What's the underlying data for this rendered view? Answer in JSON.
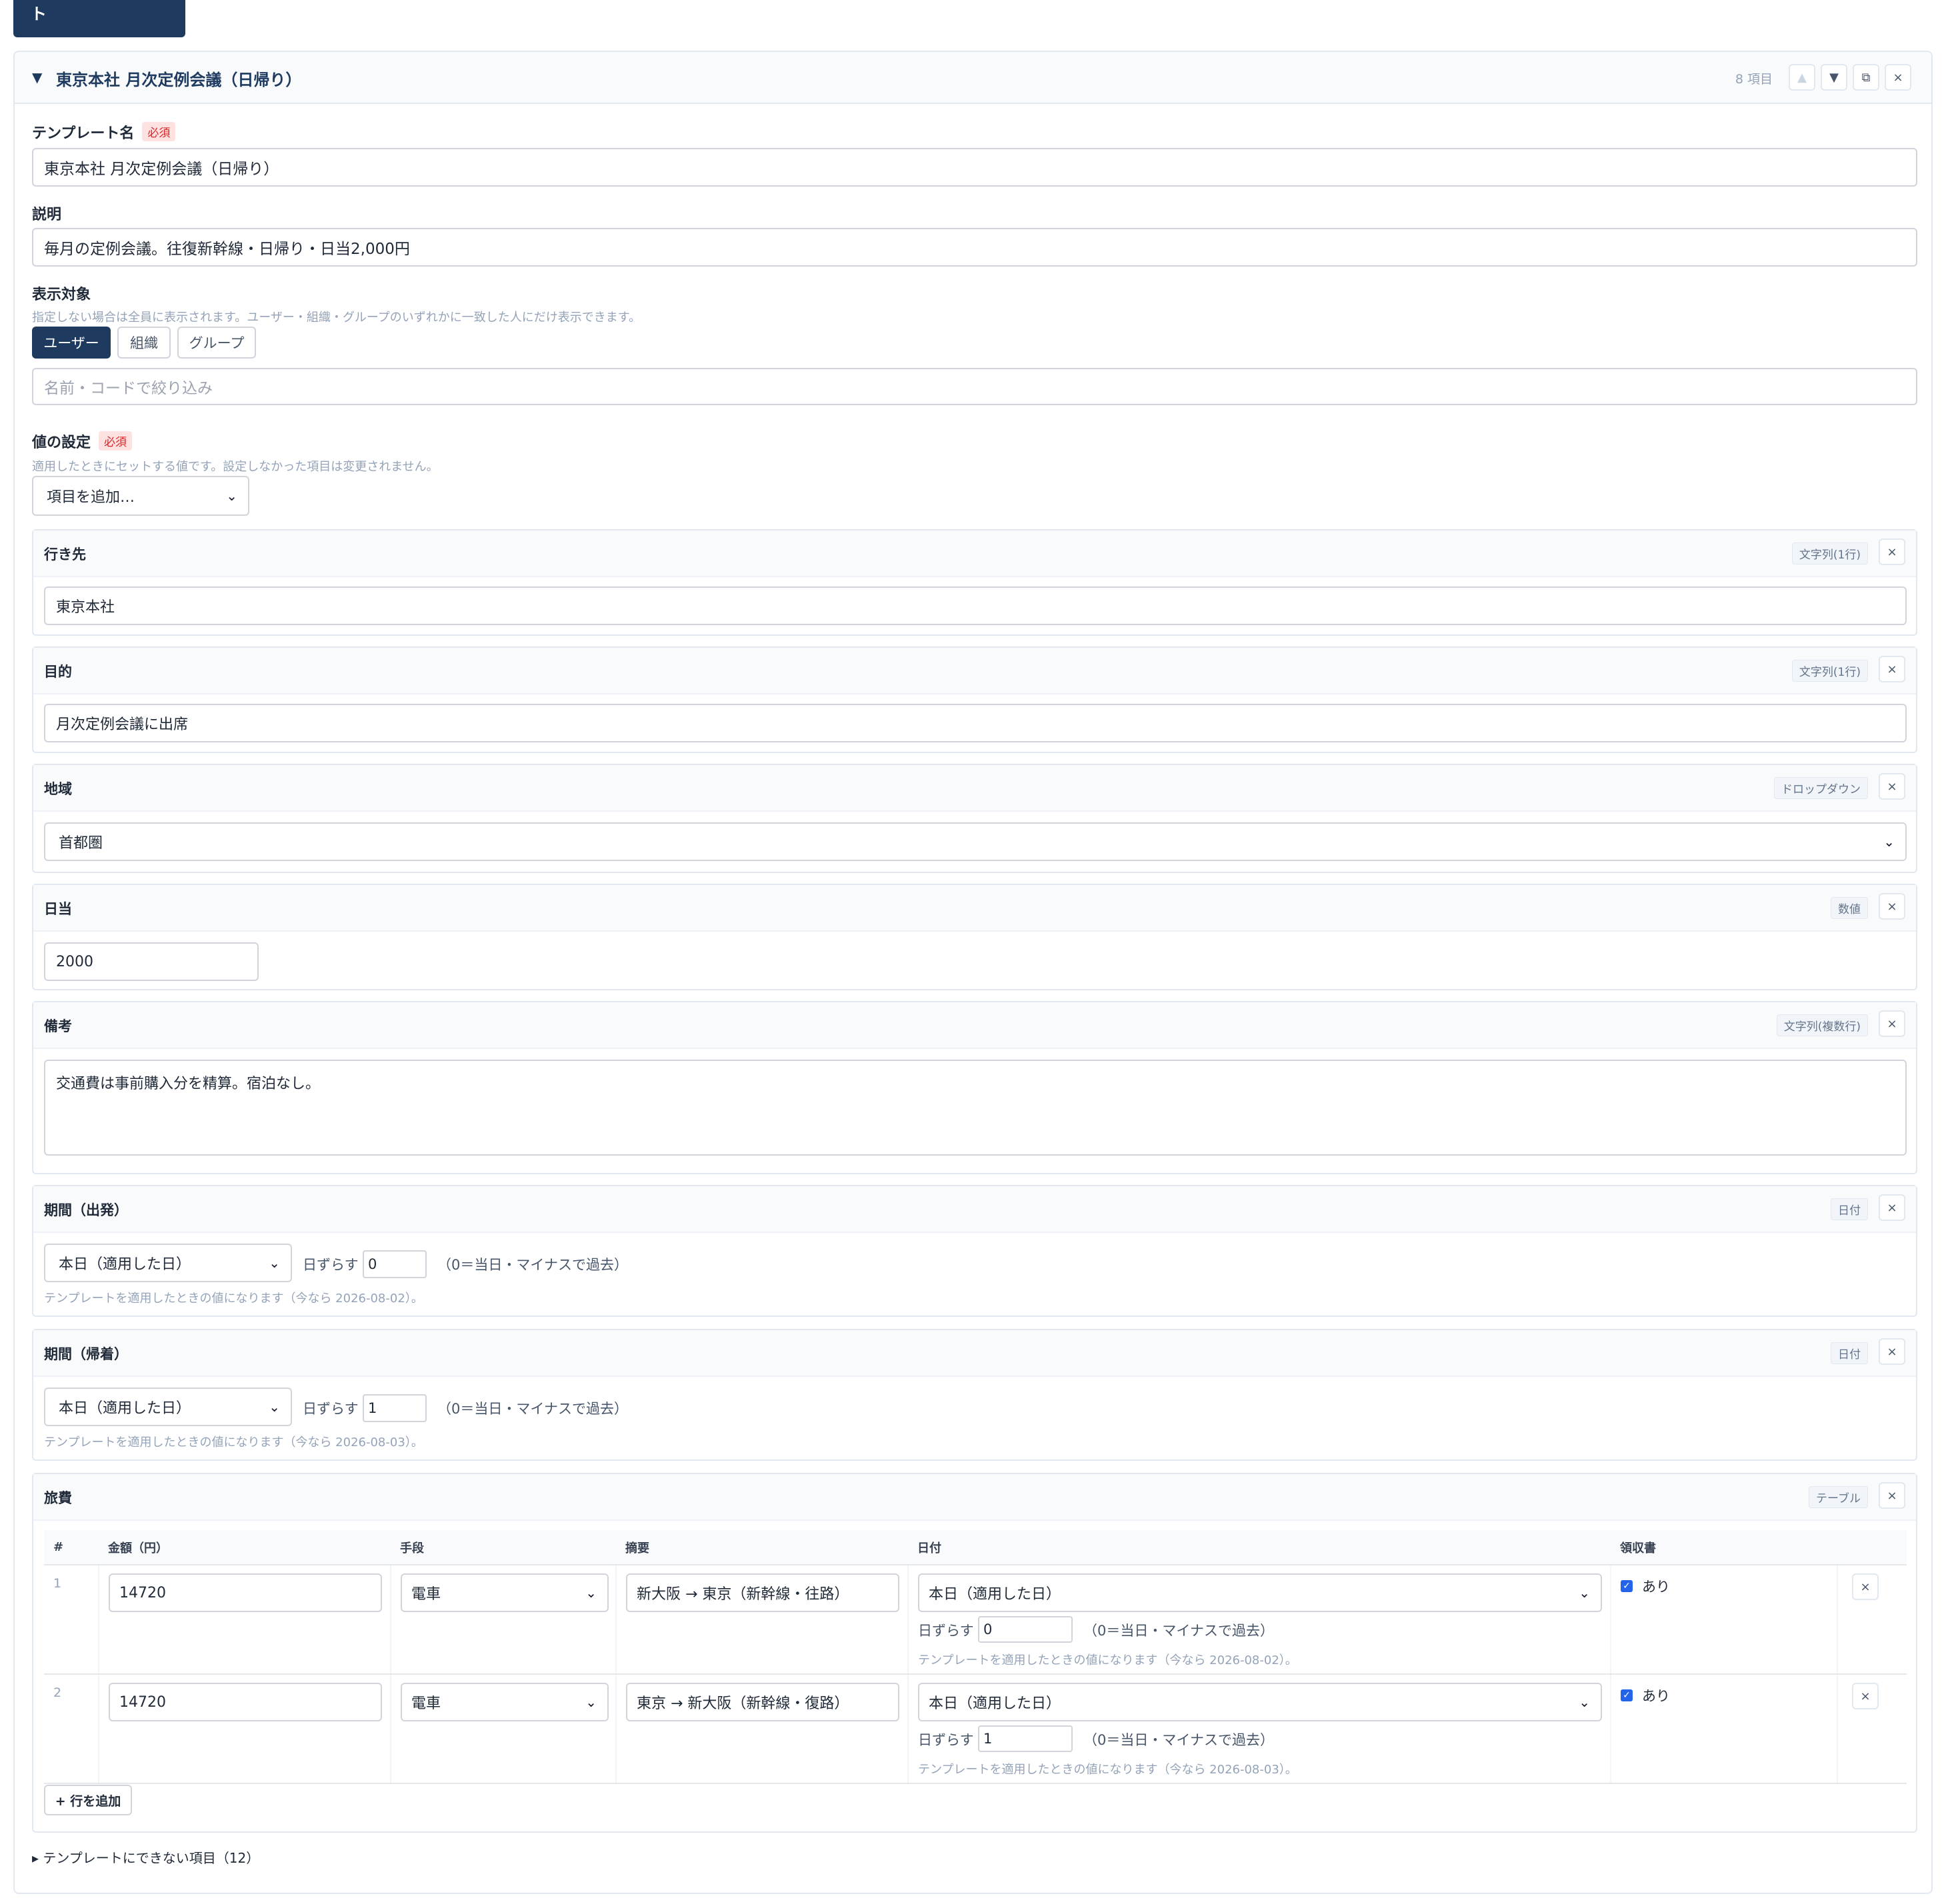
{
  "top": {
    "new_button": "+ 新しいテンプレート"
  },
  "header": {
    "caret": "▼",
    "title": "東京本社 月次定例会議（日帰り）",
    "count": "8 項目",
    "up": "▲",
    "down": "▼",
    "copy": "⧉",
    "close": "×"
  },
  "form": {
    "name_label": "テンプレート名",
    "required": "必須",
    "name_value": "東京本社 月次定例会議（日帰り）",
    "desc_label": "説明",
    "desc_value": "毎月の定例会議。往復新幹線・日帰り・日当2,000円",
    "target_label": "表示対象",
    "target_hint": "指定しない場合は全員に表示されます。ユーザー・組織・グループのいずれかに一致した人にだけ表示できます。",
    "target_tabs": [
      "ユーザー",
      "組織",
      "グループ"
    ],
    "filter_placeholder": "名前・コードで絞り込み",
    "values_label": "値の設定",
    "values_hint": "適用したときにセットする値です。設定しなかった項目は変更されません。",
    "add_item": "項目を追加…"
  },
  "fields": {
    "destination": {
      "name": "行き先",
      "type": "文字列(1行)",
      "value": "東京本社"
    },
    "purpose": {
      "name": "目的",
      "type": "文字列(1行)",
      "value": "月次定例会議に出席"
    },
    "region": {
      "name": "地域",
      "type": "ドロップダウン",
      "value": "首都圏"
    },
    "allowance": {
      "name": "日当",
      "type": "数値",
      "value": "2000"
    },
    "remarks": {
      "name": "備考",
      "type": "文字列(複数行)",
      "value": "交通費は事前購入分を精算。宿泊なし。"
    },
    "depart": {
      "name": "期間（出発）",
      "type": "日付",
      "select": "本日（適用した日）",
      "shift_label": "日ずらす",
      "shift": "0",
      "shift_note": "（0＝当日・マイナスで過去）",
      "preview": "テンプレートを適用したときの値になります（今なら 2026-08-02）。"
    },
    "return": {
      "name": "期間（帰着）",
      "type": "日付",
      "select": "本日（適用した日）",
      "shift_label": "日ずらす",
      "shift": "1",
      "shift_note": "（0＝当日・マイナスで過去）",
      "preview": "テンプレートを適用したときの値になります（今なら 2026-08-03）。"
    },
    "travel": {
      "name": "旅費",
      "type": "テーブル",
      "columns": [
        "#",
        "金額（円）",
        "手段",
        "摘要",
        "日付",
        "領収書",
        ""
      ],
      "rows": [
        {
          "num": "1",
          "amount": "14720",
          "method": "電車",
          "summary": "新大阪 → 東京（新幹線・往路）",
          "date": "本日（適用した日）",
          "shift_label": "日ずらす",
          "shift": "0",
          "shift_note": "（0＝当日・マイナスで過去）",
          "preview": "テンプレートを適用したときの値になります（今なら 2026-08-02）。",
          "receipt": "あり"
        },
        {
          "num": "2",
          "amount": "14720",
          "method": "電車",
          "summary": "東京 → 新大阪（新幹線・復路）",
          "date": "本日（適用した日）",
          "shift_label": "日ずらす",
          "shift": "1",
          "shift_note": "（0＝当日・マイナスで過去）",
          "preview": "テンプレートを適用したときの値になります（今なら 2026-08-03）。",
          "receipt": "あり"
        }
      ],
      "add_row": "+ 行を追加"
    }
  },
  "footer": {
    "non_template": "▸ テンプレートにできない項目（12）"
  },
  "colors": {
    "accent": "#1e3a5f",
    "required_bg": "#fee2e2",
    "required_fg": "#dc2626",
    "check": "#2563eb"
  },
  "icons": {
    "chevron": "chevron-down-icon",
    "close": "close-icon",
    "copy": "copy-icon",
    "up": "arrow-up-icon",
    "down": "arrow-down-icon"
  }
}
